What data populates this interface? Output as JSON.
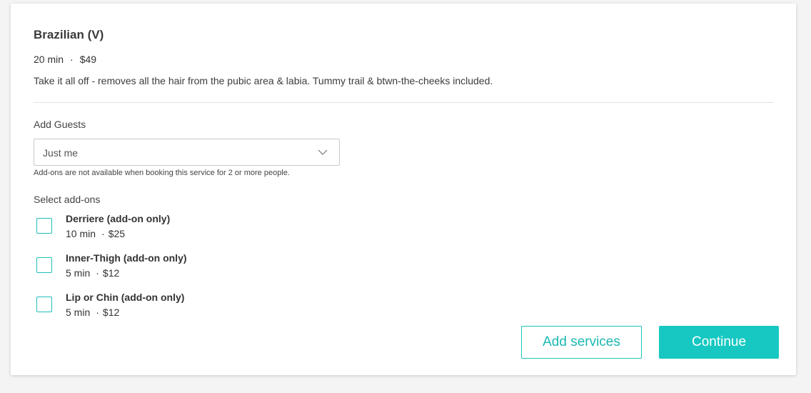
{
  "service": {
    "title": "Brazilian (V)",
    "duration": "20 min",
    "separator": "·",
    "price": "$49",
    "description": "Take it all off - removes all the hair from the pubic area & labia. Tummy trail & btwn-the-cheeks included."
  },
  "guests": {
    "label": "Add Guests",
    "selected": "Just me",
    "note": "Add-ons are not available when booking this service for 2 or more people."
  },
  "addons": {
    "label": "Select add-ons",
    "items": [
      {
        "name": "Derriere (add-on only)",
        "duration": "10 min",
        "separator": "·",
        "price": "$25",
        "checked": false
      },
      {
        "name": "Inner-Thigh (add-on only)",
        "duration": "5 min",
        "separator": "·",
        "price": "$12",
        "checked": false
      },
      {
        "name": "Lip or Chin (add-on only)",
        "duration": "5 min",
        "separator": "·",
        "price": "$12",
        "checked": false
      }
    ]
  },
  "actions": {
    "add_services": "Add services",
    "continue": "Continue"
  },
  "icons": {
    "dropdown": "chevron-down-icon"
  },
  "colors": {
    "accent": "#16c8c1",
    "checkbox_border": "#1fbfb8"
  }
}
